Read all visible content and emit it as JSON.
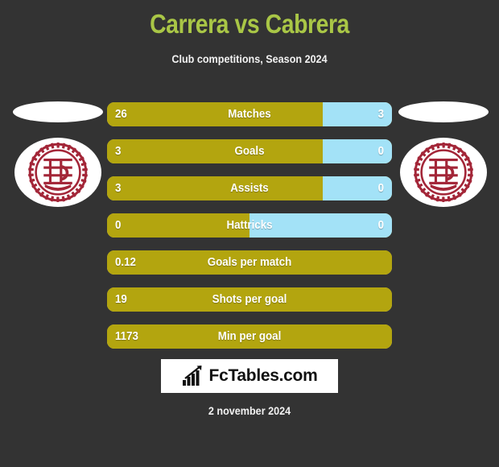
{
  "header": {
    "title": "Carrera vs Cabrera",
    "subtitle": "Club competitions, Season 2024",
    "title_color": "#a9c646"
  },
  "theme": {
    "background": "#333333",
    "home_color": "#b3a50f",
    "away_color": "#a3e2f7",
    "crest_color": "#a32638",
    "text_color": "#ffffff"
  },
  "teams": {
    "home": {
      "crest_name": "lanus-crest",
      "crest_color": "#a32638"
    },
    "away": {
      "crest_name": "lanus-crest",
      "crest_color": "#a32638"
    }
  },
  "stats": [
    {
      "label": "Matches",
      "home": "26",
      "away": "3",
      "home_pct": 75.7,
      "two_sided": true
    },
    {
      "label": "Goals",
      "home": "3",
      "away": "0",
      "home_pct": 75.7,
      "two_sided": true
    },
    {
      "label": "Assists",
      "home": "3",
      "away": "0",
      "home_pct": 75.7,
      "two_sided": true
    },
    {
      "label": "Hattricks",
      "home": "0",
      "away": "0",
      "home_pct": 50.0,
      "two_sided": true
    },
    {
      "label": "Goals per match",
      "home": "0.12",
      "away": "",
      "home_pct": 100,
      "two_sided": false
    },
    {
      "label": "Shots per goal",
      "home": "19",
      "away": "",
      "home_pct": 100,
      "two_sided": false
    },
    {
      "label": "Min per goal",
      "home": "1173",
      "away": "",
      "home_pct": 100,
      "two_sided": false
    }
  ],
  "watermark": {
    "text": "FcTables.com",
    "icon": "bar-chart-icon"
  },
  "footer": {
    "date": "2 november 2024"
  }
}
